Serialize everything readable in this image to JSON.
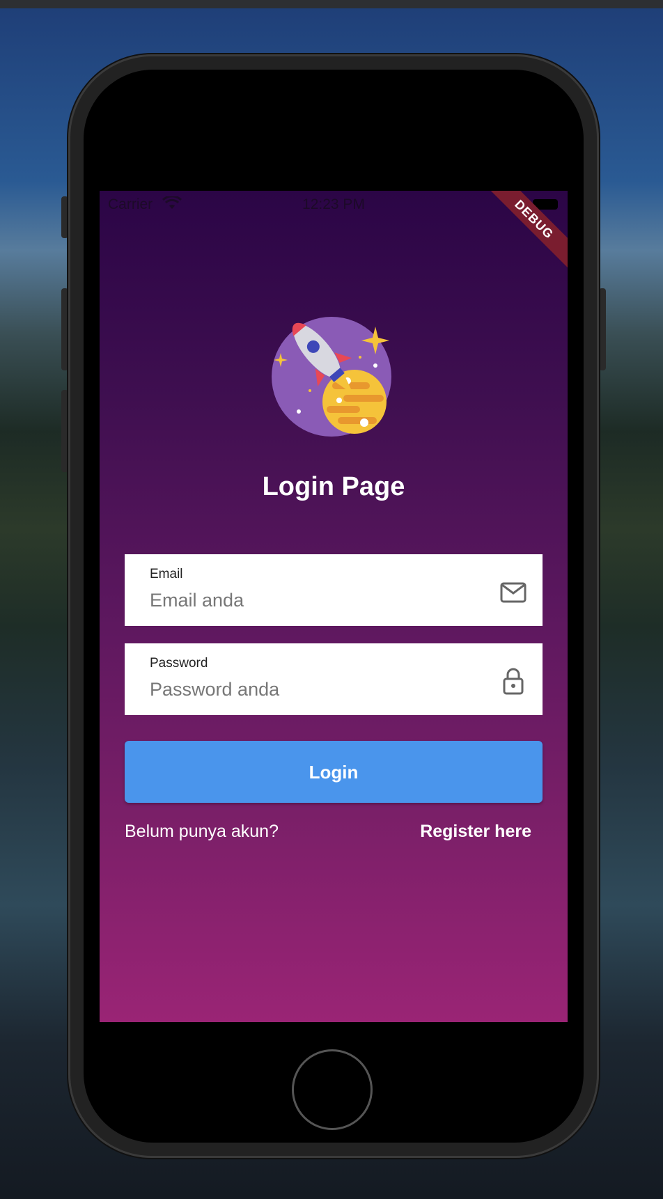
{
  "status_bar": {
    "carrier": "Carrier",
    "time": "12:23 PM",
    "debug_banner": "DEBUG"
  },
  "header": {
    "title": "Login Page",
    "logo": "rocket-planet-icon"
  },
  "form": {
    "email": {
      "label": "Email",
      "placeholder": "Email anda",
      "value": "",
      "icon": "mail-icon"
    },
    "password": {
      "label": "Password",
      "placeholder": "Password anda",
      "value": "",
      "icon": "lock-icon"
    },
    "login_button": "Login"
  },
  "footer": {
    "prompt": "Belum punya akun?",
    "register_link": "Register here"
  },
  "colors": {
    "gradient_top": "#2b0546",
    "gradient_bottom": "#9a2475",
    "button": "#4a95ec",
    "debug_ribbon": "#7a1d2f"
  }
}
